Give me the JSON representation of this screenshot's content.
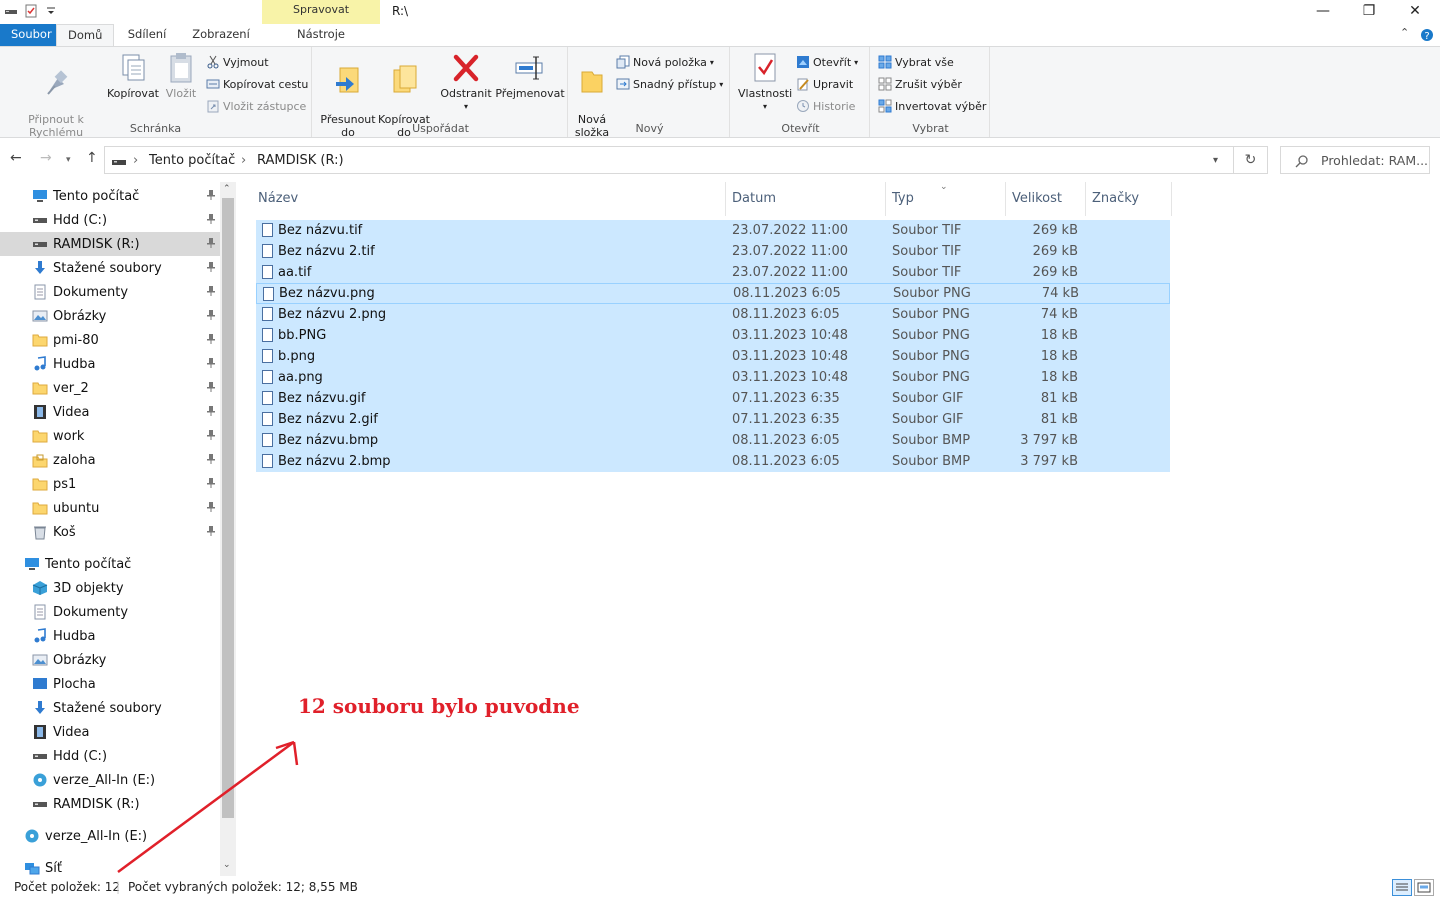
{
  "window": {
    "title": "R:\\",
    "context_tab_group": "Spravovat",
    "controls": {
      "minimize": "—",
      "restore": "❐",
      "close": "✕"
    }
  },
  "tabs": [
    "Soubor",
    "Domů",
    "Sdílení",
    "Zobrazení",
    "Nástroje obrázků"
  ],
  "ribbon": {
    "clipboard": {
      "label": "Schránka",
      "pin": "Připnout k\nRychlému přístupu",
      "copy": "Kopírovat",
      "paste": "Vložit",
      "cut": "Vyjmout",
      "copy_path": "Kopírovat cestu",
      "paste_shortcut": "Vložit zástupce"
    },
    "organize": {
      "label": "Uspořádat",
      "move_to": "Přesunout\ndo",
      "copy_to": "Kopírovat\ndo",
      "delete": "Odstranit",
      "rename": "Přejmenovat"
    },
    "new": {
      "label": "Nový",
      "new_folder": "Nová\nsložka",
      "new_item": "Nová položka",
      "easy_access": "Snadný přístup"
    },
    "open": {
      "label": "Otevřít",
      "properties": "Vlastnosti",
      "open": "Otevřít",
      "edit": "Upravit",
      "history": "Historie"
    },
    "select": {
      "label": "Vybrat",
      "select_all": "Vybrat vše",
      "select_none": "Zrušit výběr",
      "invert": "Invertovat výběr"
    }
  },
  "address": {
    "crumbs": [
      "Tento počítač",
      "RAMDISK (R:)"
    ],
    "search_placeholder": "Prohledat: RAM..."
  },
  "sidebar": {
    "quick_access": [
      {
        "label": "Tento počítač",
        "icon": "pc-icon"
      },
      {
        "label": "Hdd (C:)",
        "icon": "drive-icon"
      },
      {
        "label": "RAMDISK (R:)",
        "icon": "drive-icon"
      },
      {
        "label": "Stažené soubory",
        "icon": "download-icon"
      },
      {
        "label": "Dokumenty",
        "icon": "documents-icon"
      },
      {
        "label": "Obrázky",
        "icon": "pictures-icon"
      },
      {
        "label": "pmi-80",
        "icon": "folder-icon"
      },
      {
        "label": "Hudba",
        "icon": "music-icon"
      },
      {
        "label": "ver_2",
        "icon": "folder-icon"
      },
      {
        "label": "Videa",
        "icon": "video-icon"
      },
      {
        "label": "work",
        "icon": "folder-icon"
      },
      {
        "label": "zaloha",
        "icon": "lock-folder-icon"
      },
      {
        "label": "ps1",
        "icon": "folder-icon"
      },
      {
        "label": "ubuntu",
        "icon": "folder-icon"
      },
      {
        "label": "Koš",
        "icon": "recycle-bin-icon"
      }
    ],
    "this_pc": {
      "label": "Tento počítač",
      "icon": "pc-icon"
    },
    "this_pc_items": [
      {
        "label": "3D objekty",
        "icon": "3d-objects-icon"
      },
      {
        "label": "Dokumenty",
        "icon": "documents-icon"
      },
      {
        "label": "Hudba",
        "icon": "music-icon"
      },
      {
        "label": "Obrázky",
        "icon": "pictures-icon"
      },
      {
        "label": "Plocha",
        "icon": "desktop-icon"
      },
      {
        "label": "Stažené soubory",
        "icon": "download-icon"
      },
      {
        "label": "Videa",
        "icon": "video-icon"
      },
      {
        "label": "Hdd (C:)",
        "icon": "drive-icon"
      },
      {
        "label": "verze_All-In (E:)",
        "icon": "disc-icon"
      },
      {
        "label": "RAMDISK (R:)",
        "icon": "drive-icon"
      }
    ],
    "root_items": [
      {
        "label": "verze_All-In (E:)",
        "icon": "disc-icon"
      },
      {
        "label": "Síť",
        "icon": "network-icon"
      }
    ]
  },
  "columns": [
    "Název",
    "Datum",
    "Typ",
    "Velikost",
    "Značky"
  ],
  "files": [
    {
      "name": "Bez názvu.tif",
      "date": "23.07.2022 11:00",
      "type": "Soubor TIF",
      "size": "269 kB"
    },
    {
      "name": "Bez názvu 2.tif",
      "date": "23.07.2022 11:00",
      "type": "Soubor TIF",
      "size": "269 kB"
    },
    {
      "name": "aa.tif",
      "date": "23.07.2022 11:00",
      "type": "Soubor TIF",
      "size": "269 kB"
    },
    {
      "name": "Bez názvu.png",
      "date": "08.11.2023 6:05",
      "type": "Soubor PNG",
      "size": "74 kB"
    },
    {
      "name": "Bez názvu 2.png",
      "date": "08.11.2023 6:05",
      "type": "Soubor PNG",
      "size": "74 kB"
    },
    {
      "name": "bb.PNG",
      "date": "03.11.2023 10:48",
      "type": "Soubor PNG",
      "size": "18 kB"
    },
    {
      "name": "b.png",
      "date": "03.11.2023 10:48",
      "type": "Soubor PNG",
      "size": "18 kB"
    },
    {
      "name": "aa.png",
      "date": "03.11.2023 10:48",
      "type": "Soubor PNG",
      "size": "18 kB"
    },
    {
      "name": "Bez názvu.gif",
      "date": "07.11.2023 6:35",
      "type": "Soubor GIF",
      "size": "81 kB"
    },
    {
      "name": "Bez názvu 2.gif",
      "date": "07.11.2023 6:35",
      "type": "Soubor GIF",
      "size": "81 kB"
    },
    {
      "name": "Bez názvu.bmp",
      "date": "08.11.2023 6:05",
      "type": "Soubor BMP",
      "size": "3 797 kB"
    },
    {
      "name": "Bez názvu 2.bmp",
      "date": "08.11.2023 6:05",
      "type": "Soubor BMP",
      "size": "3 797 kB"
    }
  ],
  "annotation": {
    "text": "12 souboru bylo puvodne",
    "color": "#e0202a"
  },
  "status": {
    "count": "Počet položek: 12",
    "selected": "Počet vybraných položek: 12; 8,55 MB"
  },
  "colors": {
    "accent": "#1979ca",
    "selection": "#cce8ff",
    "context_tab": "#f8f3a8"
  }
}
